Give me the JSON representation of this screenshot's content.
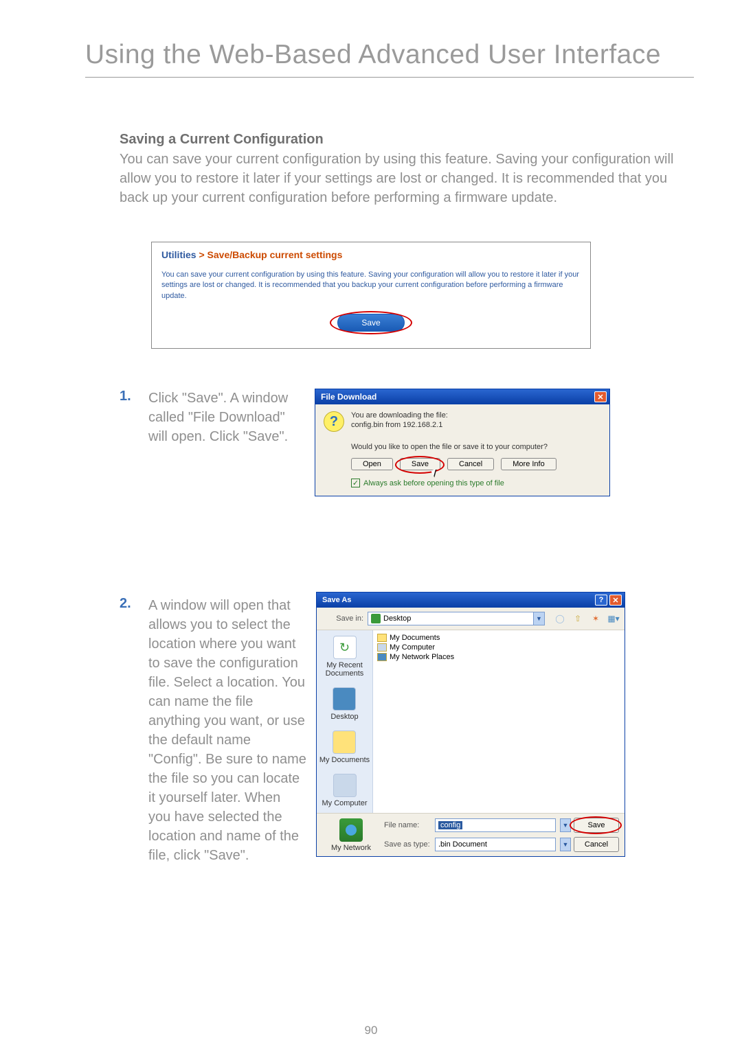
{
  "page_title": "Using the Web-Based Advanced User Interface",
  "section_heading": "Saving a Current Configuration",
  "intro": "You can save your current configuration by using this feature. Saving your configuration will allow you to restore it later if your settings are lost or changed. It is recommended that you back up your current configuration before performing a firmware update.",
  "util_panel": {
    "crumb_utilities": "Utilities",
    "crumb_sep": " > ",
    "crumb_page": "Save/Backup current settings",
    "desc": "You can save your current configuration by using this feature. Saving your configuration will allow you to restore it later if your settings are lost or changed. It is recommended that you backup your current configuration before performing a firmware update.",
    "save_label": "Save"
  },
  "step1": {
    "num": "1.",
    "text": "Click \"Save\". A window called \"File Download\" will open. Click \"Save\"."
  },
  "file_download": {
    "title": "File Download",
    "line1": "You are downloading the file:",
    "line2": "config.bin from 192.168.2.1",
    "line3": "Would you like to open the file or save it to your computer?",
    "open": "Open",
    "save": "Save",
    "cancel": "Cancel",
    "more": "More Info",
    "always": "Always ask before opening this type of file"
  },
  "step2": {
    "num": "2.",
    "text": "A window will open that allows you to select the location where you want to save the configuration file. Select a location. You can name the file anything you want, or use the default name \"Config\". Be sure to name the file so you can locate it yourself later. When you have selected the location and name of the file, click \"Save\"."
  },
  "save_as": {
    "title": "Save As",
    "save_in_label": "Save in:",
    "save_in_value": "Desktop",
    "items": {
      "a": "My Documents",
      "b": "My Computer",
      "c": "My Network Places"
    },
    "places": {
      "recent": "My Recent Documents",
      "desktop": "Desktop",
      "mydocs": "My Documents",
      "mycomp": "My Computer",
      "mynet": "My Network"
    },
    "file_name_label": "File name:",
    "file_name_value": "config",
    "save_type_label": "Save as type:",
    "save_type_value": ".bin Document",
    "save_btn": "Save",
    "cancel_btn": "Cancel"
  },
  "page_number": "90"
}
